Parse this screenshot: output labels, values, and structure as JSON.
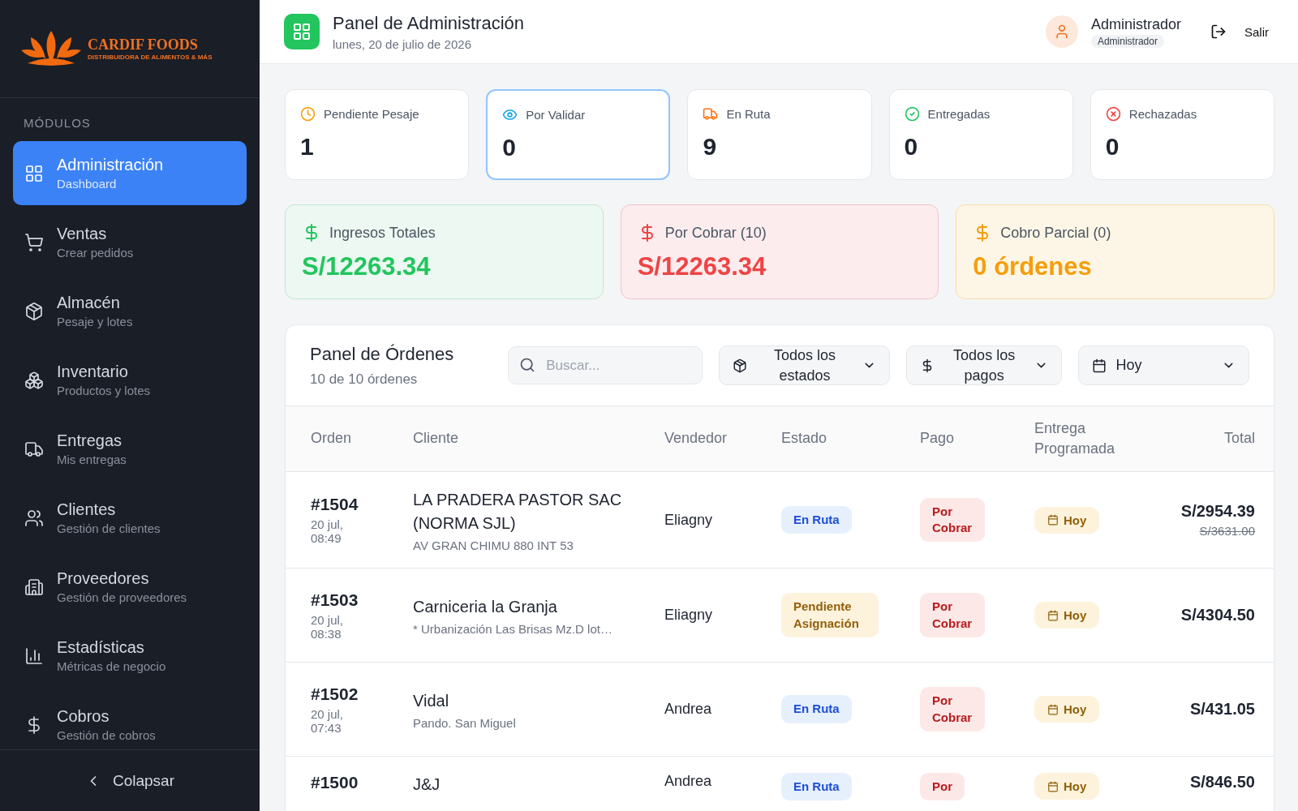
{
  "sidebar": {
    "logo": {
      "name": "CARDIF FOODS",
      "tagline": "DISTRIBUIDORA DE ALIMENTOS & MÁS"
    },
    "section": "MÓDULOS",
    "items": [
      {
        "label": "Administración",
        "sub": "Dashboard",
        "selected": true
      },
      {
        "label": "Ventas",
        "sub": "Crear pedidos",
        "selected": false
      },
      {
        "label": "Almacén",
        "sub": "Pesaje y lotes",
        "selected": false
      },
      {
        "label": "Inventario",
        "sub": "Productos y lotes",
        "selected": false
      },
      {
        "label": "Entregas",
        "sub": "Mis entregas",
        "selected": false
      },
      {
        "label": "Clientes",
        "sub": "Gestión de clientes",
        "selected": false
      },
      {
        "label": "Proveedores",
        "sub": "Gestión de proveedores",
        "selected": false
      },
      {
        "label": "Estadísticas",
        "sub": "Métricas de negocio",
        "selected": false
      },
      {
        "label": "Cobros",
        "sub": "Gestión de cobros",
        "selected": false
      }
    ],
    "collapse": "Colapsar"
  },
  "header": {
    "title": "Panel de Administración",
    "date": "lunes, 20 de julio de 2026",
    "user": {
      "name": "Administrador",
      "role": "Administrador"
    },
    "logout": "Salir"
  },
  "stats": [
    {
      "kind": "pending",
      "label": "Pendiente Pesaje",
      "value": "1",
      "selected": false
    },
    {
      "kind": "validate",
      "label": "Por Validar",
      "value": "0",
      "selected": true
    },
    {
      "kind": "route",
      "label": "En Ruta",
      "value": "9",
      "selected": false
    },
    {
      "kind": "delivered",
      "label": "Entregadas",
      "value": "0",
      "selected": false
    },
    {
      "kind": "rejected",
      "label": "Rechazadas",
      "value": "0",
      "selected": false
    }
  ],
  "money": [
    {
      "kind": "green",
      "label": "Ingresos Totales",
      "value": "S/12263.34"
    },
    {
      "kind": "red",
      "label": "Por Cobrar (10)",
      "value": "S/12263.34"
    },
    {
      "kind": "amber",
      "label": "Cobro Parcial (0)",
      "value": "0 órdenes"
    }
  ],
  "orders": {
    "title": "Panel de Órdenes",
    "count": "10 de 10 órdenes",
    "search": {
      "placeholder": "Buscar..."
    },
    "filters": [
      {
        "kind": "box",
        "label": "Todos los estados"
      },
      {
        "kind": "dollar",
        "label": "Todos los pagos"
      },
      {
        "kind": "calendar",
        "label": "Hoy"
      }
    ],
    "columns": [
      "Orden",
      "Cliente",
      "Vendedor",
      "Estado",
      "Pago",
      "Entrega Programada",
      "Total"
    ],
    "rows": [
      {
        "order": "#1504",
        "date": "20 jul, 08:49",
        "client": "LA PRADERA PASTOR SAC (NORMA SJL)",
        "address": "AV GRAN CHIMU 880 INT 53",
        "seller": "Eliagny",
        "status": {
          "kind": "route",
          "label": "En Ruta"
        },
        "payment": {
          "kind": "unpaid",
          "label": "Por Cobrar"
        },
        "delivery": "Hoy",
        "total": "S/2954.39",
        "original_total": "S/3631.00"
      },
      {
        "order": "#1503",
        "date": "20 jul, 08:38",
        "client": "Carniceria la Granja",
        "address": "* Urbanización Las Brisas Mz.D lot…",
        "seller": "Eliagny",
        "status": {
          "kind": "pending",
          "label": "Pendiente Asignación"
        },
        "payment": {
          "kind": "unpaid",
          "label": "Por Cobrar"
        },
        "delivery": "Hoy",
        "total": "S/4304.50"
      },
      {
        "order": "#1502",
        "date": "20 jul, 07:43",
        "client": "Vidal",
        "address": "Pando. San Miguel",
        "seller": "Andrea",
        "status": {
          "kind": "route",
          "label": "En Ruta"
        },
        "payment": {
          "kind": "unpaid",
          "label": "Por Cobrar"
        },
        "delivery": "Hoy",
        "total": "S/431.05"
      },
      {
        "order": "#1500",
        "client": "J&J",
        "seller": "Andrea",
        "status": {
          "kind": "route",
          "label": "En Ruta"
        },
        "payment": {
          "kind": "unpaid",
          "label": "Por"
        },
        "delivery": "Hoy",
        "total": "S/846.50"
      }
    ]
  }
}
